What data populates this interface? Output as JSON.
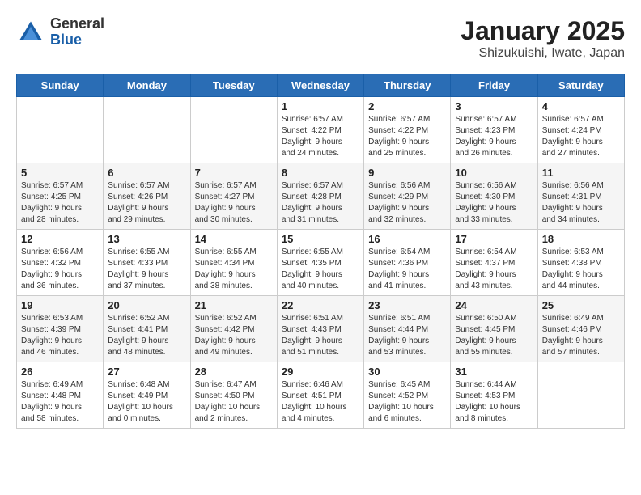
{
  "header": {
    "logo_general": "General",
    "logo_blue": "Blue",
    "main_title": "January 2025",
    "subtitle": "Shizukuishi, Iwate, Japan"
  },
  "weekdays": [
    "Sunday",
    "Monday",
    "Tuesday",
    "Wednesday",
    "Thursday",
    "Friday",
    "Saturday"
  ],
  "weeks": [
    [
      {
        "day": "",
        "content": ""
      },
      {
        "day": "",
        "content": ""
      },
      {
        "day": "",
        "content": ""
      },
      {
        "day": "1",
        "content": "Sunrise: 6:57 AM\nSunset: 4:22 PM\nDaylight: 9 hours\nand 24 minutes."
      },
      {
        "day": "2",
        "content": "Sunrise: 6:57 AM\nSunset: 4:22 PM\nDaylight: 9 hours\nand 25 minutes."
      },
      {
        "day": "3",
        "content": "Sunrise: 6:57 AM\nSunset: 4:23 PM\nDaylight: 9 hours\nand 26 minutes."
      },
      {
        "day": "4",
        "content": "Sunrise: 6:57 AM\nSunset: 4:24 PM\nDaylight: 9 hours\nand 27 minutes."
      }
    ],
    [
      {
        "day": "5",
        "content": "Sunrise: 6:57 AM\nSunset: 4:25 PM\nDaylight: 9 hours\nand 28 minutes."
      },
      {
        "day": "6",
        "content": "Sunrise: 6:57 AM\nSunset: 4:26 PM\nDaylight: 9 hours\nand 29 minutes."
      },
      {
        "day": "7",
        "content": "Sunrise: 6:57 AM\nSunset: 4:27 PM\nDaylight: 9 hours\nand 30 minutes."
      },
      {
        "day": "8",
        "content": "Sunrise: 6:57 AM\nSunset: 4:28 PM\nDaylight: 9 hours\nand 31 minutes."
      },
      {
        "day": "9",
        "content": "Sunrise: 6:56 AM\nSunset: 4:29 PM\nDaylight: 9 hours\nand 32 minutes."
      },
      {
        "day": "10",
        "content": "Sunrise: 6:56 AM\nSunset: 4:30 PM\nDaylight: 9 hours\nand 33 minutes."
      },
      {
        "day": "11",
        "content": "Sunrise: 6:56 AM\nSunset: 4:31 PM\nDaylight: 9 hours\nand 34 minutes."
      }
    ],
    [
      {
        "day": "12",
        "content": "Sunrise: 6:56 AM\nSunset: 4:32 PM\nDaylight: 9 hours\nand 36 minutes."
      },
      {
        "day": "13",
        "content": "Sunrise: 6:55 AM\nSunset: 4:33 PM\nDaylight: 9 hours\nand 37 minutes."
      },
      {
        "day": "14",
        "content": "Sunrise: 6:55 AM\nSunset: 4:34 PM\nDaylight: 9 hours\nand 38 minutes."
      },
      {
        "day": "15",
        "content": "Sunrise: 6:55 AM\nSunset: 4:35 PM\nDaylight: 9 hours\nand 40 minutes."
      },
      {
        "day": "16",
        "content": "Sunrise: 6:54 AM\nSunset: 4:36 PM\nDaylight: 9 hours\nand 41 minutes."
      },
      {
        "day": "17",
        "content": "Sunrise: 6:54 AM\nSunset: 4:37 PM\nDaylight: 9 hours\nand 43 minutes."
      },
      {
        "day": "18",
        "content": "Sunrise: 6:53 AM\nSunset: 4:38 PM\nDaylight: 9 hours\nand 44 minutes."
      }
    ],
    [
      {
        "day": "19",
        "content": "Sunrise: 6:53 AM\nSunset: 4:39 PM\nDaylight: 9 hours\nand 46 minutes."
      },
      {
        "day": "20",
        "content": "Sunrise: 6:52 AM\nSunset: 4:41 PM\nDaylight: 9 hours\nand 48 minutes."
      },
      {
        "day": "21",
        "content": "Sunrise: 6:52 AM\nSunset: 4:42 PM\nDaylight: 9 hours\nand 49 minutes."
      },
      {
        "day": "22",
        "content": "Sunrise: 6:51 AM\nSunset: 4:43 PM\nDaylight: 9 hours\nand 51 minutes."
      },
      {
        "day": "23",
        "content": "Sunrise: 6:51 AM\nSunset: 4:44 PM\nDaylight: 9 hours\nand 53 minutes."
      },
      {
        "day": "24",
        "content": "Sunrise: 6:50 AM\nSunset: 4:45 PM\nDaylight: 9 hours\nand 55 minutes."
      },
      {
        "day": "25",
        "content": "Sunrise: 6:49 AM\nSunset: 4:46 PM\nDaylight: 9 hours\nand 57 minutes."
      }
    ],
    [
      {
        "day": "26",
        "content": "Sunrise: 6:49 AM\nSunset: 4:48 PM\nDaylight: 9 hours\nand 58 minutes."
      },
      {
        "day": "27",
        "content": "Sunrise: 6:48 AM\nSunset: 4:49 PM\nDaylight: 10 hours\nand 0 minutes."
      },
      {
        "day": "28",
        "content": "Sunrise: 6:47 AM\nSunset: 4:50 PM\nDaylight: 10 hours\nand 2 minutes."
      },
      {
        "day": "29",
        "content": "Sunrise: 6:46 AM\nSunset: 4:51 PM\nDaylight: 10 hours\nand 4 minutes."
      },
      {
        "day": "30",
        "content": "Sunrise: 6:45 AM\nSunset: 4:52 PM\nDaylight: 10 hours\nand 6 minutes."
      },
      {
        "day": "31",
        "content": "Sunrise: 6:44 AM\nSunset: 4:53 PM\nDaylight: 10 hours\nand 8 minutes."
      },
      {
        "day": "",
        "content": ""
      }
    ]
  ]
}
